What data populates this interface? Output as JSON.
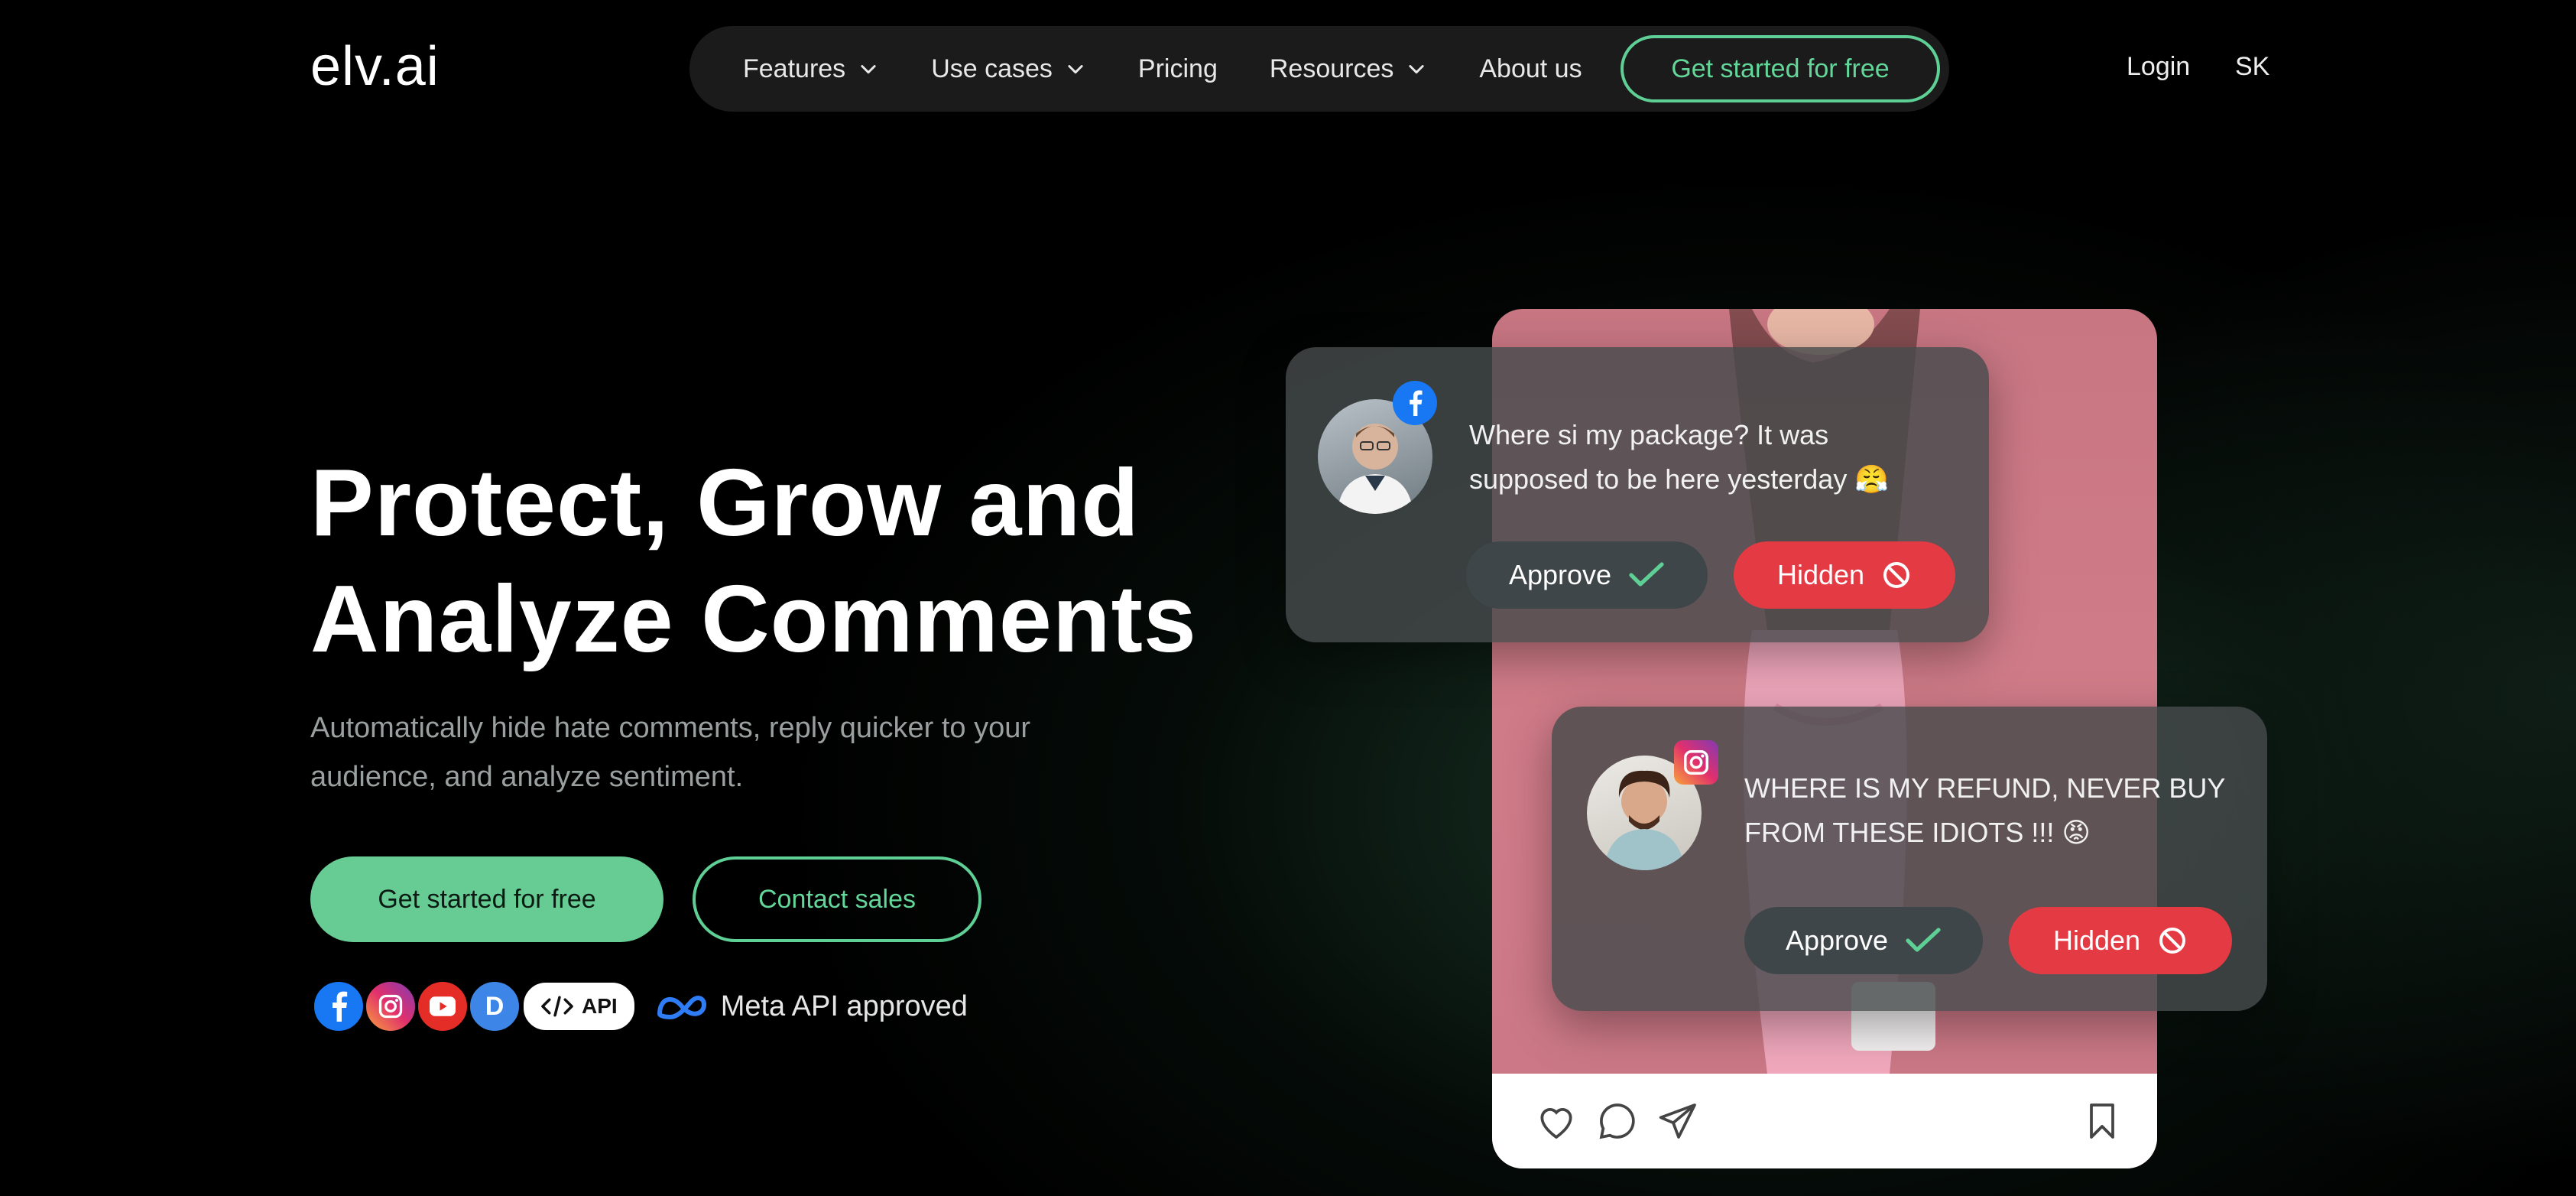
{
  "header": {
    "logo": "elv.ai",
    "nav": [
      {
        "label": "Features",
        "dropdown": true
      },
      {
        "label": "Use cases",
        "dropdown": true
      },
      {
        "label": "Pricing",
        "dropdown": false
      },
      {
        "label": "Resources",
        "dropdown": true
      },
      {
        "label": "About us",
        "dropdown": false
      }
    ],
    "cta_label": "Get started for free",
    "login_label": "Login",
    "language_label": "SK"
  },
  "hero": {
    "title_line1": "Protect, Grow and",
    "title_line2": "Analyze Comments",
    "subtitle_line1": "Automatically hide hate comments, reply quicker to your",
    "subtitle_line2": "audience, and analyze sentiment.",
    "primary_button": "Get started for free",
    "secondary_button": "Contact sales",
    "platform_icons": [
      "facebook-icon",
      "instagram-icon",
      "youtube-icon",
      "d-icon"
    ],
    "api_label": "API",
    "meta_label": "Meta API approved"
  },
  "comments": [
    {
      "platform": "facebook",
      "text_line1": "Where si my package? It was",
      "text_line2": "supposed to be here yesterday 😤",
      "approve_label": "Approve",
      "hidden_label": "Hidden"
    },
    {
      "platform": "instagram",
      "text_line1": "WHERE IS MY REFUND, NEVER BUY",
      "text_line2": "FROM THESE IDIOTS !!! 😡",
      "approve_label": "Approve",
      "hidden_label": "Hidden"
    }
  ],
  "colors": {
    "accent_green": "#66cc93",
    "danger_red": "#e43a44",
    "facebook_blue": "#1877f2",
    "background": "#000000"
  }
}
